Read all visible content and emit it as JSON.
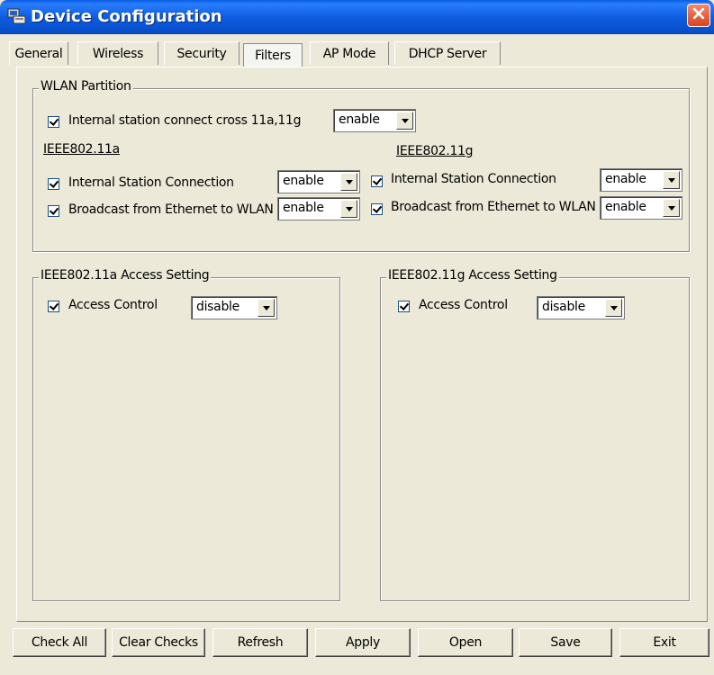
{
  "window": {
    "title": "Device Configuration"
  },
  "tabs": [
    {
      "label": "General"
    },
    {
      "label": "Wireless"
    },
    {
      "label": "Security"
    },
    {
      "label": "Filters"
    },
    {
      "label": "AP Mode"
    },
    {
      "label": "DHCP Server"
    }
  ],
  "active_tab": "Filters",
  "wlan_partition": {
    "title": "WLAN Partition",
    "cross": {
      "label": "Internal station connect cross 11a,11g",
      "checked": true,
      "value": "enable"
    },
    "a": {
      "heading": "IEEE802.11a",
      "internal": {
        "label": "Internal Station Connection",
        "checked": true,
        "value": "enable"
      },
      "broadcast": {
        "label": "Broadcast from Ethernet to WLAN",
        "checked": true,
        "value": "enable"
      }
    },
    "g": {
      "heading": "IEEE802.11g",
      "internal": {
        "label": "Internal Station Connection",
        "checked": true,
        "value": "enable"
      },
      "broadcast": {
        "label": "Broadcast from Ethernet to WLAN",
        "checked": true,
        "value": "enable"
      }
    }
  },
  "access_a": {
    "title": "IEEE802.11a Access Setting",
    "control_label": "Access Control",
    "checked": true,
    "value": "disable"
  },
  "access_g": {
    "title": "IEEE802.11g Access Setting",
    "control_label": "Access Control",
    "checked": true,
    "value": "disable"
  },
  "buttons": {
    "check_all": "Check All",
    "clear_checks": "Clear Checks",
    "refresh": "Refresh",
    "apply": "Apply",
    "open": "Open",
    "save": "Save",
    "exit": "Exit"
  },
  "colors": {
    "titlebar": "#0a5ee4",
    "face": "#ece9d8",
    "close": "#d9431e"
  }
}
